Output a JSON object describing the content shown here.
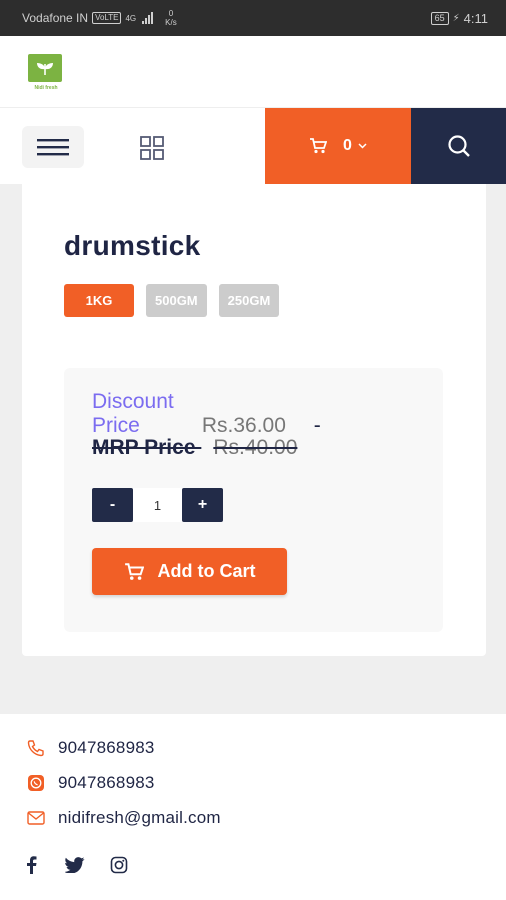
{
  "status_bar": {
    "carrier": "Vodafone IN",
    "volte": "VoLTE",
    "network": "4G",
    "speed_value": "0",
    "speed_unit": "K/s",
    "battery": "65",
    "time": "4:11"
  },
  "header": {
    "logo_text": "Nidi fresh"
  },
  "nav": {
    "cart_count": "0"
  },
  "product": {
    "name": "drumstick",
    "variants": [
      {
        "label": "1KG",
        "active": true
      },
      {
        "label": "500GM",
        "active": false
      },
      {
        "label": "250GM",
        "active": false
      }
    ],
    "discount_label": "Discount Price",
    "discount_price": "Rs.36.00",
    "separator": "-",
    "mrp_label": "MRP Price",
    "mrp_price": "Rs.40.00",
    "qty_minus": "-",
    "qty_value": "1",
    "qty_plus": "+",
    "add_to_cart": "Add to Cart"
  },
  "footer": {
    "phone": "9047868983",
    "whatsapp": "9047868983",
    "email": "nidifresh@gmail.com"
  },
  "colors": {
    "accent": "#f15f26",
    "navy": "#222b48",
    "discount_label": "#7b6cf0",
    "brand_green": "#7cb342"
  },
  "icons": {
    "menu": "hamburger-menu-icon",
    "grid": "grid-icon",
    "cart": "cart-icon",
    "search": "search-icon",
    "phone": "phone-icon",
    "whatsapp": "whatsapp-icon",
    "email": "email-icon",
    "facebook": "facebook-icon",
    "twitter": "twitter-icon",
    "instagram": "instagram-icon"
  }
}
